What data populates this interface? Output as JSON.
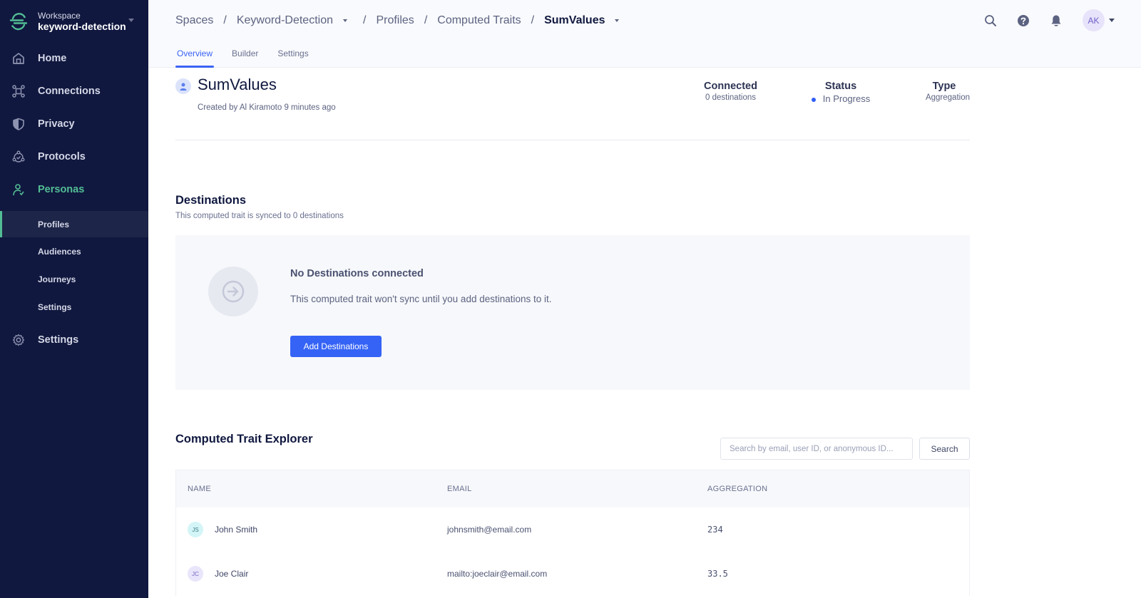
{
  "workspace": {
    "label": "Workspace",
    "name": "keyword-detection"
  },
  "sidebar": {
    "items": [
      {
        "label": "Home",
        "icon": "home-icon"
      },
      {
        "label": "Connections",
        "icon": "connections-icon"
      },
      {
        "label": "Privacy",
        "icon": "shield-icon"
      },
      {
        "label": "Protocols",
        "icon": "protocols-icon"
      },
      {
        "label": "Personas",
        "icon": "personas-icon",
        "active": true
      },
      {
        "label": "Settings",
        "icon": "gear-icon"
      }
    ],
    "subitems": [
      {
        "label": "Profiles",
        "selected": true
      },
      {
        "label": "Audiences"
      },
      {
        "label": "Journeys"
      },
      {
        "label": "Settings"
      }
    ]
  },
  "header": {
    "breadcrumbs": [
      "Spaces",
      "Keyword-Detection",
      "Profiles",
      "Computed Traits",
      "SumValues"
    ],
    "tabs": [
      {
        "label": "Overview",
        "active": true
      },
      {
        "label": "Builder"
      },
      {
        "label": "Settings"
      }
    ],
    "user_initials": "AK"
  },
  "trait": {
    "title": "SumValues",
    "meta": "Created by Al Kiramoto 9 minutes ago",
    "stats": {
      "connected_label": "Connected",
      "connected_value": "0 destinations",
      "status_label": "Status",
      "status_value": "In Progress",
      "type_label": "Type",
      "type_value": "Aggregation"
    }
  },
  "destinations": {
    "title": "Destinations",
    "subtitle": "This computed trait is synced to 0 destinations",
    "empty_title": "No Destinations connected",
    "empty_text": "This computed trait won't sync until you add destinations to it.",
    "add_button": "Add Destinations"
  },
  "explorer": {
    "title": "Computed Trait Explorer",
    "search_placeholder": "Search by email, user ID, or anonymous ID...",
    "search_button": "Search",
    "columns": [
      "NAME",
      "EMAIL",
      "AGGREGATION"
    ],
    "rows": [
      {
        "initials": "JS",
        "name": "John Smith",
        "email": "johnsmith@email.com",
        "aggregation": "234",
        "avatar_bg": "#d4f5f7",
        "avatar_fg": "#3c7d86"
      },
      {
        "initials": "JC",
        "name": "Joe Clair",
        "email": "mailto:joeclair@email.com",
        "aggregation": "33.5",
        "avatar_bg": "#e9e5fb",
        "avatar_fg": "#7468c0"
      }
    ]
  },
  "colors": {
    "sidebar_bg": "#10183f",
    "accent_green": "#52bd94",
    "primary_blue": "#3563f6"
  }
}
